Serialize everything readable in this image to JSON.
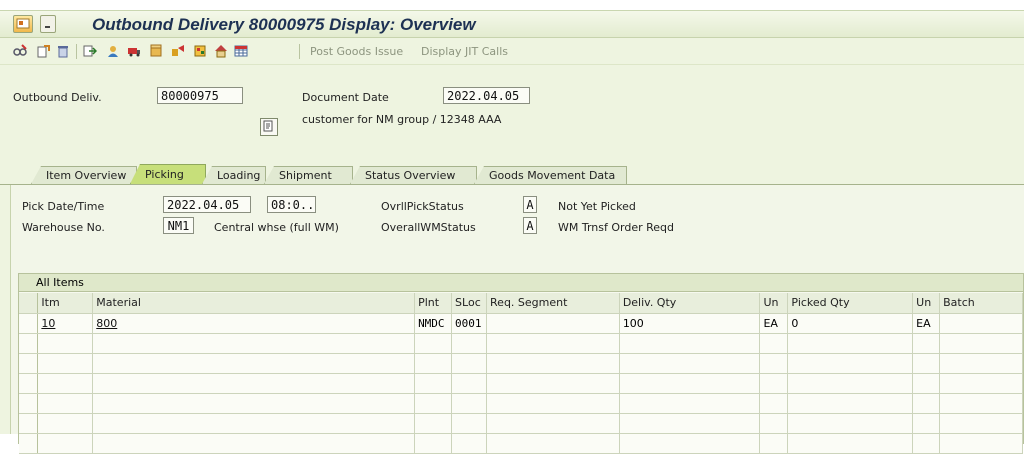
{
  "window": {
    "title": "Outbound Delivery 80000975 Display: Overview"
  },
  "toolbar": {
    "post_goods_issue": "Post Goods Issue",
    "display_jit_calls": "Display JIT Calls",
    "icons": [
      "glasses-edit-icon",
      "document-change-icon",
      "delete-icon",
      "output-icon",
      "partner-icon",
      "truck-icon",
      "package-icon",
      "services-icon",
      "house-icon",
      "grid-icon"
    ]
  },
  "header": {
    "outbound_deliv_label": "Outbound Deliv.",
    "outbound_deliv_value": "80000975",
    "document_date_label": "Document Date",
    "document_date_value": "2022.04.05",
    "customer_text": "customer for NM group / 12348 AAA"
  },
  "tabs": [
    {
      "label": "Item Overview",
      "active": false
    },
    {
      "label": "Picking",
      "active": true
    },
    {
      "label": "Loading",
      "active": false
    },
    {
      "label": "Shipment",
      "active": false
    },
    {
      "label": "Status Overview",
      "active": false
    },
    {
      "label": "Goods Movement Data",
      "active": false
    }
  ],
  "picking": {
    "pick_date_label": "Pick Date/Time",
    "pick_date_value": "2022.04.05",
    "pick_time_value": "08:0..",
    "warehouse_label": "Warehouse No.",
    "warehouse_value": "NM1",
    "warehouse_desc": "Central whse (full WM)",
    "ovrl_pick_status_label": "OvrllPickStatus",
    "ovrl_pick_status_value": "A",
    "ovrl_pick_status_desc": "Not Yet Picked",
    "overall_wm_status_label": "OverallWMStatus",
    "overall_wm_status_value": "A",
    "overall_wm_status_desc": "WM Trnsf Order Reqd"
  },
  "grid": {
    "title": "All Items",
    "columns": [
      "Itm",
      "Material",
      "Plnt",
      "SLoc",
      "Req. Segment",
      "Deliv. Qty",
      "Un",
      "Picked Qty",
      "Un",
      "Batch"
    ],
    "rows": [
      {
        "itm": "10",
        "material": "800",
        "plnt": "NMDC",
        "sloc": "0001",
        "req_segment": "",
        "deliv_qty": "100",
        "un": "EA",
        "picked_qty": "0",
        "un2": "EA",
        "batch": ""
      }
    ]
  },
  "colors": {
    "title_text": "#1d3153",
    "active_tab": "#c7df7a",
    "background": "#eef4e0"
  }
}
